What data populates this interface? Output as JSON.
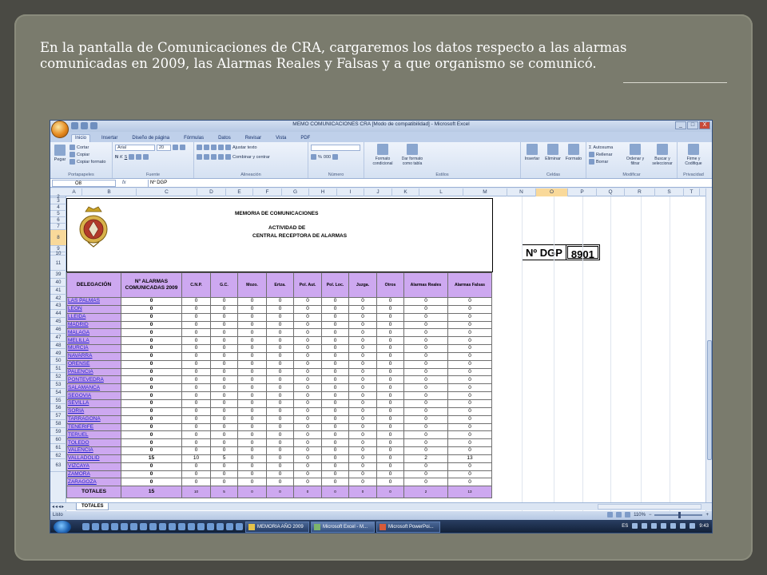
{
  "caption": {
    "line1": "En la pantalla de Comunicaciones de CRA, cargaremos los datos respecto a las alarmas",
    "line2": "comunicadas en 2009, las Alarmas Reales y Falsas y a que organismo se comunicó."
  },
  "window": {
    "title": "MEMO COMUNICACIONES CRA  [Modo de compatibilidad] - Microsoft Excel",
    "controls": [
      "_",
      "□",
      "X"
    ]
  },
  "ribbon": {
    "tabs": [
      "Inicio",
      "Insertar",
      "Diseño de página",
      "Fórmulas",
      "Datos",
      "Revisar",
      "Vista",
      "PDF"
    ],
    "active_tab": "Inicio",
    "clipboard": {
      "paste": "Pegar",
      "cut": "Cortar",
      "copy": "Copiar",
      "format_painter": "Copiar formato",
      "label": "Portapapeles"
    },
    "font": {
      "name": "Arial",
      "size": "20",
      "bold": "N",
      "italic": "K",
      "underline": "S",
      "label": "Fuente"
    },
    "alignment": {
      "wrap": "Ajustar texto",
      "merge": "Combinar y centrar",
      "label": "Alineación"
    },
    "number": {
      "percent": "%",
      "thousands": "000",
      "label": "Número"
    },
    "styles": {
      "conditional": "Formato condicional",
      "as_table": "Dar formato como tabla",
      "label": "Estilos"
    },
    "cells": {
      "insert": "Insertar",
      "delete": "Eliminar",
      "format": "Formato",
      "label": "Celdas"
    },
    "editing": {
      "autosum": "Autosuma",
      "fill": "Rellenar",
      "clear": "Borrar",
      "sort": "Ordenar y filtrar",
      "find": "Buscar y seleccionar",
      "label": "Modificar"
    },
    "privacy": {
      "sign": "Firme y Codifique",
      "label": "Privacidad"
    }
  },
  "formula_bar": {
    "name_box": "O8",
    "fx": "fx",
    "value": "Nº DGP"
  },
  "columns": [
    "A",
    "B",
    "C",
    "D",
    "E",
    "F",
    "G",
    "H",
    "I",
    "J",
    "K",
    "L",
    "M",
    "N",
    "O",
    "P",
    "Q",
    "R",
    "S",
    "T"
  ],
  "row_numbers": [
    "2",
    "3",
    "4",
    "5",
    "6",
    "7",
    "8",
    "9",
    "10",
    "11",
    "39",
    "40",
    "41",
    "42",
    "43",
    "44",
    "45",
    "46",
    "47",
    "48",
    "49",
    "50",
    "51",
    "52",
    "53",
    "54",
    "55",
    "56",
    "57",
    "58",
    "59",
    "60",
    "61",
    "62",
    "63"
  ],
  "memo": {
    "title": "MEMORIA DE COMUNICACIONES",
    "subtitle1": "ACTIVIDAD DE",
    "subtitle2": "CENTRAL RECEPTORA DE ALARMAS"
  },
  "dgp": {
    "label": "Nº DGP",
    "value": "8901"
  },
  "table": {
    "headers": [
      "DELEGACIÓN",
      "Nº ALARMAS COMUNICADAS 2009",
      "C.N.P.",
      "G.C.",
      "Mozo.",
      "Ertza.",
      "Pol. Aut.",
      "Pol. Loc.",
      "Juzga.",
      "Otros",
      "Alarmas Reales",
      "Alarmas Falsas"
    ],
    "rows": [
      {
        "name": "LAS PALMAS",
        "vals": [
          "0",
          "0",
          "0",
          "0",
          "0",
          "0",
          "0",
          "0",
          "0",
          "0",
          "0"
        ]
      },
      {
        "name": "LEON",
        "vals": [
          "0",
          "0",
          "0",
          "0",
          "0",
          "0",
          "0",
          "0",
          "0",
          "0",
          "0"
        ]
      },
      {
        "name": "LLEIDA",
        "vals": [
          "0",
          "0",
          "0",
          "0",
          "0",
          "0",
          "0",
          "0",
          "0",
          "0",
          "0"
        ]
      },
      {
        "name": "MADRID",
        "vals": [
          "0",
          "0",
          "0",
          "0",
          "0",
          "0",
          "0",
          "0",
          "0",
          "0",
          "0"
        ]
      },
      {
        "name": "MALAGA",
        "vals": [
          "0",
          "0",
          "0",
          "0",
          "0",
          "0",
          "0",
          "0",
          "0",
          "0",
          "0"
        ]
      },
      {
        "name": "MELILLA",
        "vals": [
          "0",
          "0",
          "0",
          "0",
          "0",
          "0",
          "0",
          "0",
          "0",
          "0",
          "0"
        ]
      },
      {
        "name": "MURCIA",
        "vals": [
          "0",
          "0",
          "0",
          "0",
          "0",
          "0",
          "0",
          "0",
          "0",
          "0",
          "0"
        ]
      },
      {
        "name": "NAVARRA",
        "vals": [
          "0",
          "0",
          "0",
          "0",
          "0",
          "0",
          "0",
          "0",
          "0",
          "0",
          "0"
        ]
      },
      {
        "name": "ORENSE",
        "vals": [
          "0",
          "0",
          "0",
          "0",
          "0",
          "0",
          "0",
          "0",
          "0",
          "0",
          "0"
        ]
      },
      {
        "name": "PALENCIA",
        "vals": [
          "0",
          "0",
          "0",
          "0",
          "0",
          "0",
          "0",
          "0",
          "0",
          "0",
          "0"
        ]
      },
      {
        "name": "PONTEVEDRA",
        "vals": [
          "0",
          "0",
          "0",
          "0",
          "0",
          "0",
          "0",
          "0",
          "0",
          "0",
          "0"
        ]
      },
      {
        "name": "SALAMANCA",
        "vals": [
          "0",
          "0",
          "0",
          "0",
          "0",
          "0",
          "0",
          "0",
          "0",
          "0",
          "0"
        ]
      },
      {
        "name": "SEGOVIA",
        "vals": [
          "0",
          "0",
          "0",
          "0",
          "0",
          "0",
          "0",
          "0",
          "0",
          "0",
          "0"
        ]
      },
      {
        "name": "SEVILLA",
        "vals": [
          "0",
          "0",
          "0",
          "0",
          "0",
          "0",
          "0",
          "0",
          "0",
          "0",
          "0"
        ]
      },
      {
        "name": "SORIA",
        "vals": [
          "0",
          "0",
          "0",
          "0",
          "0",
          "0",
          "0",
          "0",
          "0",
          "0",
          "0"
        ]
      },
      {
        "name": "TARRAGONA",
        "vals": [
          "0",
          "0",
          "0",
          "0",
          "0",
          "0",
          "0",
          "0",
          "0",
          "0",
          "0"
        ]
      },
      {
        "name": "TENERIFE",
        "vals": [
          "0",
          "0",
          "0",
          "0",
          "0",
          "0",
          "0",
          "0",
          "0",
          "0",
          "0"
        ]
      },
      {
        "name": "TERUEL",
        "vals": [
          "0",
          "0",
          "0",
          "0",
          "0",
          "0",
          "0",
          "0",
          "0",
          "0",
          "0"
        ]
      },
      {
        "name": "TOLEDO",
        "vals": [
          "0",
          "0",
          "0",
          "0",
          "0",
          "0",
          "0",
          "0",
          "0",
          "0",
          "0"
        ]
      },
      {
        "name": "VALENCIA",
        "vals": [
          "0",
          "0",
          "0",
          "0",
          "0",
          "0",
          "0",
          "0",
          "0",
          "0",
          "0"
        ]
      },
      {
        "name": "VALLADOLID",
        "vals": [
          "15",
          "10",
          "5",
          "0",
          "0",
          "0",
          "0",
          "0",
          "0",
          "2",
          "13"
        ]
      },
      {
        "name": "VIZCAYA",
        "vals": [
          "0",
          "0",
          "0",
          "0",
          "0",
          "0",
          "0",
          "0",
          "0",
          "0",
          "0"
        ]
      },
      {
        "name": "ZAMORA",
        "vals": [
          "0",
          "0",
          "0",
          "0",
          "0",
          "0",
          "0",
          "0",
          "0",
          "0",
          "0"
        ]
      },
      {
        "name": "ZARAGOZA",
        "vals": [
          "0",
          "0",
          "0",
          "0",
          "0",
          "0",
          "0",
          "0",
          "0",
          "0",
          "0"
        ]
      }
    ],
    "totals": {
      "label": "TOTALES",
      "vals": [
        "15",
        "10",
        "5",
        "0",
        "0",
        "0",
        "0",
        "0",
        "0",
        "2",
        "13"
      ]
    }
  },
  "sheet_tab": "TOTALES",
  "status": {
    "left": "Listo",
    "zoom": "110%"
  },
  "taskbar": {
    "items": [
      "MEMORIA AÑO 2009",
      "Microsoft Excel - M...",
      "Microsoft PowerPoi..."
    ],
    "lang": "ES",
    "time": "9:43"
  }
}
